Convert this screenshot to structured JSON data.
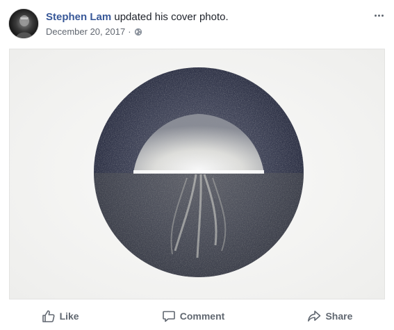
{
  "post": {
    "author_name": "Stephen Lam",
    "action_text": "updated his cover photo.",
    "date": "December 20, 2017",
    "separator": "·",
    "privacy_icon": "globe-icon",
    "menu_icon": "more-options-icon"
  },
  "actions": {
    "like_label": "Like",
    "comment_label": "Comment",
    "share_label": "Share"
  },
  "colors": {
    "author": "#385898",
    "action_text": "#606770",
    "meta": "#616770"
  }
}
